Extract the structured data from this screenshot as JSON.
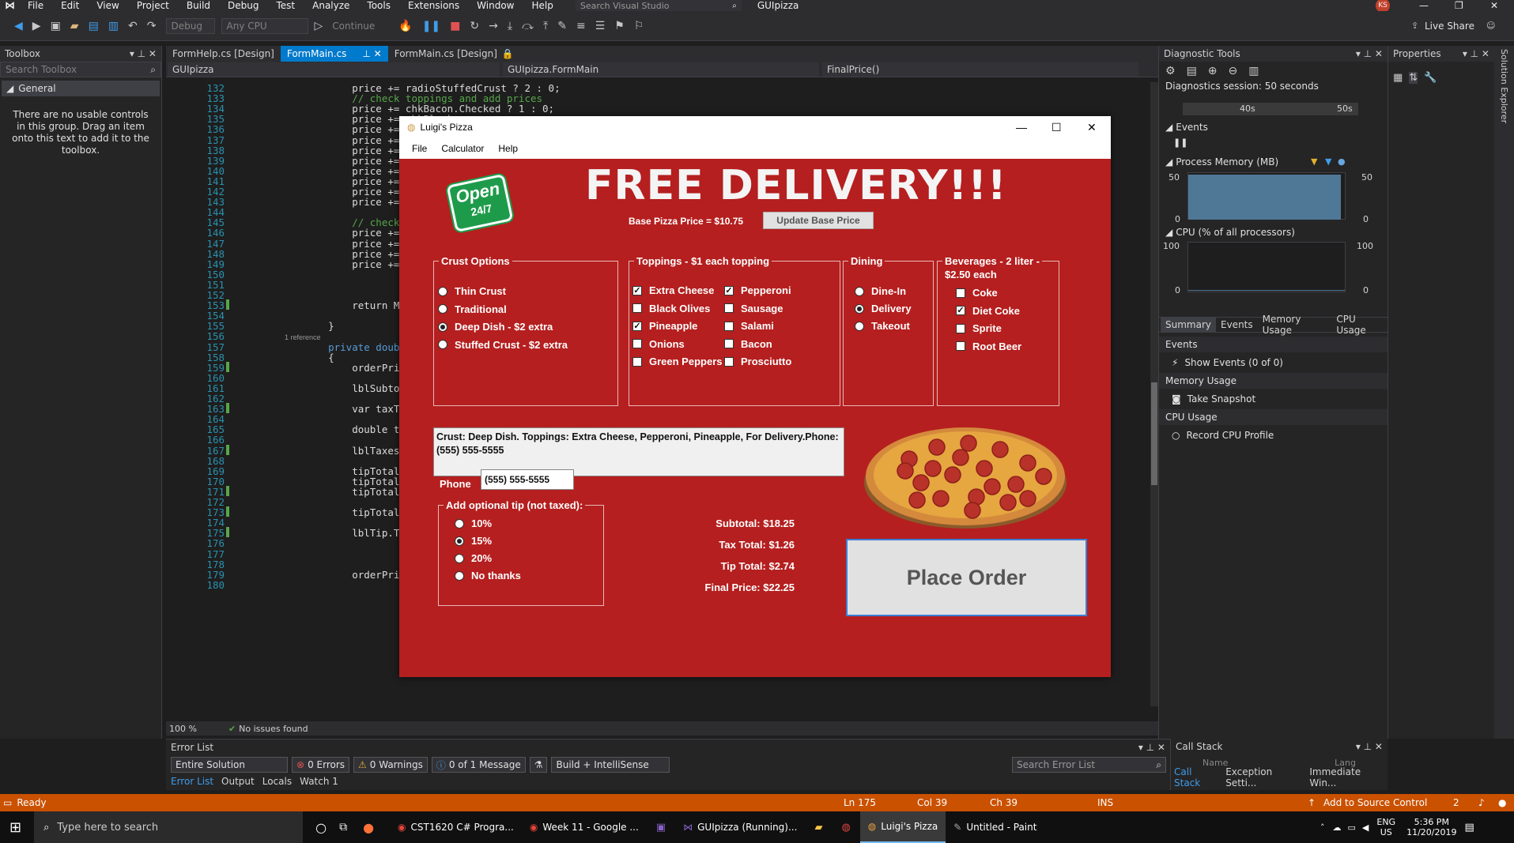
{
  "vs": {
    "menu": [
      "File",
      "Edit",
      "View",
      "Project",
      "Build",
      "Debug",
      "Test",
      "Analyze",
      "Tools",
      "Extensions",
      "Window",
      "Help"
    ],
    "search_placeholder": "Search Visual Studio",
    "solution_name": "GUIpizza",
    "avatar_initials": "KS",
    "config_debug": "Debug",
    "config_cpu": "Any CPU",
    "continue_label": "Continue",
    "live_share": "Live Share"
  },
  "toolbox": {
    "title": "Toolbox",
    "search_placeholder": "Search Toolbox",
    "group": "General",
    "empty_message": "There are no usable controls in this group. Drag an item onto this text to add it to the toolbox."
  },
  "editor": {
    "tabs": [
      "FormHelp.cs [Design]",
      "FormMain.cs",
      "FormMain.cs [Design]"
    ],
    "nav": [
      "GUIpizza",
      "GUIpizza.FormMain",
      "FinalPrice()"
    ],
    "zoom": "100 %",
    "issues": "No issues found",
    "code_lines": [
      {
        "n": "132",
        "t": "        price += radioStuffedCrust ? 2 : 0;",
        "c": ""
      },
      {
        "n": "133",
        "t": "        // check toppings and add prices",
        "c": "cm"
      },
      {
        "n": "134",
        "t": "        price += chkBacon.Checked ? 1 : 0;",
        "c": ""
      },
      {
        "n": "135",
        "t": "        price += chkBlack",
        "c": ""
      },
      {
        "n": "136",
        "t": "        price += chkChees",
        "c": ""
      },
      {
        "n": "137",
        "t": "        price += chkGreen",
        "c": ""
      },
      {
        "n": "138",
        "t": "        price += chkOnion",
        "c": ""
      },
      {
        "n": "139",
        "t": "        price += chkPeppe",
        "c": ""
      },
      {
        "n": "140",
        "t": "        price += chkPinea",
        "c": ""
      },
      {
        "n": "141",
        "t": "        price += chkProsc",
        "c": ""
      },
      {
        "n": "142",
        "t": "        price += chkSalam",
        "c": ""
      },
      {
        "n": "143",
        "t": "        price += chkSausa",
        "c": ""
      },
      {
        "n": "144",
        "t": "",
        "c": ""
      },
      {
        "n": "145",
        "t": "        // check beverage",
        "c": "cm"
      },
      {
        "n": "146",
        "t": "        price += chkCoke.",
        "c": ""
      },
      {
        "n": "147",
        "t": "        price += chkDietC",
        "c": ""
      },
      {
        "n": "148",
        "t": "        price += chkSprit",
        "c": ""
      },
      {
        "n": "149",
        "t": "        price += chkRootB",
        "c": ""
      },
      {
        "n": "150",
        "t": "",
        "c": ""
      },
      {
        "n": "151",
        "t": "",
        "c": ""
      },
      {
        "n": "152",
        "t": "",
        "c": ""
      },
      {
        "n": "153",
        "t": "        return Math.Round",
        "c": ""
      },
      {
        "n": "154",
        "t": "",
        "c": ""
      },
      {
        "n": "155",
        "t": "    }",
        "c": ""
      },
      {
        "n": "156",
        "t": "",
        "c": ""
      },
      {
        "n": "157",
        "t": "    private double FinalP",
        "c": "kw"
      },
      {
        "n": "158",
        "t": "    {",
        "c": ""
      },
      {
        "n": "159",
        "t": "        orderPrice = Math",
        "c": ""
      },
      {
        "n": "160",
        "t": "",
        "c": ""
      },
      {
        "n": "161",
        "t": "        lblSubtotal.Text",
        "c": ""
      },
      {
        "n": "162",
        "t": "",
        "c": ""
      },
      {
        "n": "163",
        "t": "        var taxTotal = Ma",
        "c": ""
      },
      {
        "n": "164",
        "t": "",
        "c": ""
      },
      {
        "n": "165",
        "t": "        double tipTotal =",
        "c": ""
      },
      {
        "n": "166",
        "t": "",
        "c": ""
      },
      {
        "n": "167",
        "t": "        lblTaxes.Text = \"",
        "c": ""
      },
      {
        "n": "168",
        "t": "",
        "c": ""
      },
      {
        "n": "169",
        "t": "        tipTotal += radBt",
        "c": ""
      },
      {
        "n": "170",
        "t": "        tipTotal += radBt",
        "c": ""
      },
      {
        "n": "171",
        "t": "        tipTotal += radBt",
        "c": ""
      },
      {
        "n": "172",
        "t": "",
        "c": ""
      },
      {
        "n": "173",
        "t": "        tipTotal = Math.R",
        "c": ""
      },
      {
        "n": "174",
        "t": "",
        "c": ""
      },
      {
        "n": "175",
        "t": "        lblTip.Text = \"Ti",
        "c": ""
      },
      {
        "n": "176",
        "t": "",
        "c": ""
      },
      {
        "n": "177",
        "t": "",
        "c": ""
      },
      {
        "n": "178",
        "t": "",
        "c": ""
      },
      {
        "n": "179",
        "t": "        orderPrice += taxTotal + tipTotal;",
        "c": ""
      },
      {
        "n": "180",
        "t": "",
        "c": ""
      }
    ],
    "reference_hint": "1 reference"
  },
  "diagnostics": {
    "title": "Diagnostic Tools",
    "session": "Diagnostics session: 50 seconds",
    "timeline_40": "40s",
    "timeline_50": "50s",
    "events": "Events",
    "process_memory": "Process Memory (MB)",
    "mem_max": "50",
    "mem_min": "0",
    "cpu": "CPU (% of all processors)",
    "cpu_max": "100",
    "cpu_min": "0",
    "tabs": [
      "Summary",
      "Events",
      "Memory Usage",
      "CPU Usage"
    ],
    "sections": [
      {
        "title": "Events",
        "item": "Show Events (0 of 0)"
      },
      {
        "title": "Memory Usage",
        "item": "Take Snapshot"
      },
      {
        "title": "CPU Usage",
        "item": "Record CPU Profile"
      }
    ]
  },
  "properties": {
    "title": "Properties",
    "side_label": "Solution Explorer"
  },
  "error_list": {
    "title": "Error List",
    "scope": "Entire Solution",
    "errors": "0 Errors",
    "warnings": "0 Warnings",
    "messages": "0 of 1 Message",
    "build_filter": "Build + IntelliSense",
    "search_placeholder": "Search Error List",
    "bottom_tabs": [
      "Error List",
      "Output",
      "Locals",
      "Watch 1"
    ]
  },
  "call_stack": {
    "title": "Call Stack",
    "cols": [
      "Name",
      "Lang"
    ],
    "bottom_tabs": [
      "Call Stack",
      "Exception Setti...",
      "Immediate Win..."
    ]
  },
  "status": {
    "ready": "Ready",
    "ln": "Ln 175",
    "col": "Col 39",
    "ch": "Ch 39",
    "ins": "INS",
    "source_control": "Add to Source Control",
    "notifications": "2"
  },
  "taskbar": {
    "search_placeholder": "Type here to search",
    "apps": [
      "CST1620 C# Progra...",
      "Week 11 - Google ...",
      "GUIpizza (Running)...",
      "Luigi's Pizza",
      "Untitled - Paint"
    ],
    "lang": "ENG",
    "region": "US",
    "time": "5:36 PM",
    "date": "11/20/2019"
  },
  "pizza": {
    "window_title": "Luigi's Pizza",
    "menu": [
      "File",
      "Calculator",
      "Help"
    ],
    "headline": "FREE DELIVERY!!!",
    "badge_line1": "Open",
    "badge_line2": "24/7",
    "base_price_label": "Base Pizza Price = $10.75",
    "update_button": "Update Base Price",
    "crust": {
      "title": "Crust Options",
      "options": [
        {
          "label": "Thin Crust",
          "selected": false
        },
        {
          "label": "Traditional",
          "selected": false
        },
        {
          "label": "Deep Dish  - $2 extra",
          "selected": true
        },
        {
          "label": "Stuffed Crust  - $2 extra",
          "selected": false
        }
      ]
    },
    "toppings": {
      "title": "Toppings  - $1 each topping",
      "col1": [
        {
          "label": "Extra Cheese",
          "checked": true
        },
        {
          "label": "Black Olives",
          "checked": false
        },
        {
          "label": "Pineapple",
          "checked": true
        },
        {
          "label": "Onions",
          "checked": false
        },
        {
          "label": "Green Peppers",
          "checked": false
        }
      ],
      "col2": [
        {
          "label": "Pepperoni",
          "checked": true
        },
        {
          "label": "Sausage",
          "checked": false
        },
        {
          "label": "Salami",
          "checked": false
        },
        {
          "label": "Bacon",
          "checked": false
        },
        {
          "label": "Prosciutto",
          "checked": false
        }
      ]
    },
    "dining": {
      "title": "Dining",
      "options": [
        {
          "label": "Dine-In",
          "selected": false
        },
        {
          "label": "Delivery",
          "selected": true
        },
        {
          "label": "Takeout",
          "selected": false
        }
      ]
    },
    "beverages": {
      "title_line1": "Beverages  - 2 liter -",
      "title_line2": "$2.50 each",
      "options": [
        {
          "label": "Coke",
          "checked": false
        },
        {
          "label": "Diet Coke",
          "checked": true
        },
        {
          "label": "Sprite",
          "checked": false
        },
        {
          "label": "Root Beer",
          "checked": false
        }
      ]
    },
    "summary_text": "Crust: Deep Dish. Toppings: Extra Cheese, Pepperoni, Pineapple, For Delivery.Phone: (555) 555-5555",
    "phone_label": "Phone",
    "phone_value": "(555) 555-5555",
    "tip": {
      "title": "Add optional tip (not taxed):",
      "options": [
        {
          "label": "10%",
          "selected": false
        },
        {
          "label": "15%",
          "selected": true
        },
        {
          "label": "20%",
          "selected": false
        },
        {
          "label": "No thanks",
          "selected": false
        }
      ]
    },
    "totals": {
      "subtotal": "Subtotal: $18.25",
      "tax": "Tax Total:  $1.26",
      "tip": "Tip Total:  $2.74",
      "final": "Final Price: $22.25"
    },
    "place_order": "Place Order"
  }
}
